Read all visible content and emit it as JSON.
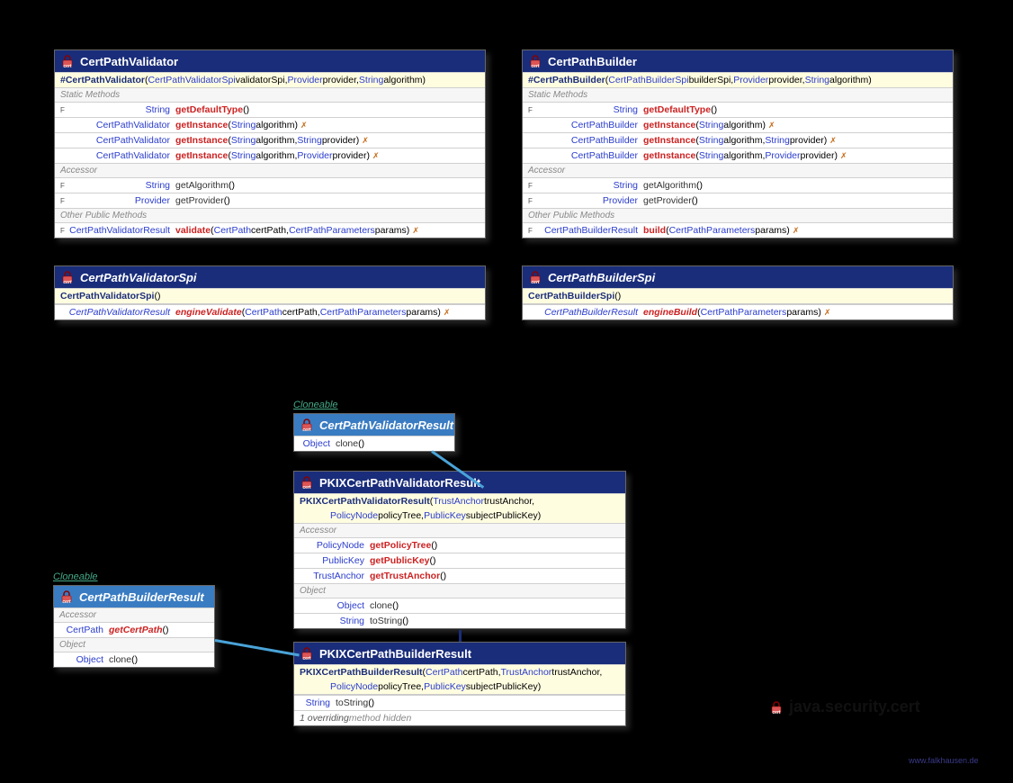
{
  "package": "java.security.cert",
  "footer": "www.falkhausen.de",
  "stereo": {
    "cloneable1": "Cloneable",
    "cloneable2": "Cloneable"
  },
  "classes": {
    "cpv": {
      "name": "CertPathValidator",
      "ctor_prefix": "#",
      "ctor": "CertPathValidator",
      "ctor_args_prefix": " (",
      "ctor_a1_t": "CertPathValidatorSpi",
      "ctor_a1_n": " validatorSpi, ",
      "ctor_a2_t": "Provider",
      "ctor_a2_n": " provider, ",
      "ctor_a3_t": "String",
      "ctor_a3_n": " algorithm)",
      "sec_static": "Static Methods",
      "m1_mod": "F",
      "m1_ret": "String",
      "m1_name": "getDefaultType",
      "m1_args": " ()",
      "m2_ret": "CertPathValidator",
      "m2_name": "getInstance",
      "m2_args_pre": " (",
      "m2_a1_t": "String",
      "m2_a1_n": " algorithm) ",
      "m2_exc": "✗",
      "m3_ret": "CertPathValidator",
      "m3_name": "getInstance",
      "m3_args_pre": " (",
      "m3_a1_t": "String",
      "m3_a1_n": " algorithm, ",
      "m3_a2_t": "String",
      "m3_a2_n": " provider) ",
      "m3_exc": "✗",
      "m4_ret": "CertPathValidator",
      "m4_name": "getInstance",
      "m4_args_pre": " (",
      "m4_a1_t": "String",
      "m4_a1_n": " algorithm, ",
      "m4_a2_t": "Provider",
      "m4_a2_n": " provider) ",
      "m4_exc": "✗",
      "sec_acc": "Accessor",
      "m5_mod": "F",
      "m5_ret": "String",
      "m5_name": "getAlgorithm",
      "m5_args": " ()",
      "m6_mod": "F",
      "m6_ret": "Provider",
      "m6_name": "getProvider",
      "m6_args": " ()",
      "sec_other": "Other Public Methods",
      "m7_mod": "F",
      "m7_ret": "CertPathValidatorResult",
      "m7_name": "validate",
      "m7_args_pre": " (",
      "m7_a1_t": "CertPath",
      "m7_a1_n": " certPath, ",
      "m7_a2_t": "CertPathParameters",
      "m7_a2_n": " params) ",
      "m7_exc": "✗"
    },
    "cpb": {
      "name": "CertPathBuilder",
      "ctor_prefix": "#",
      "ctor": "CertPathBuilder",
      "ctor_args_prefix": " (",
      "ctor_a1_t": "CertPathBuilderSpi",
      "ctor_a1_n": " builderSpi, ",
      "ctor_a2_t": "Provider",
      "ctor_a2_n": " provider, ",
      "ctor_a3_t": "String",
      "ctor_a3_n": " algorithm)",
      "sec_static": "Static Methods",
      "m1_mod": "F",
      "m1_ret": "String",
      "m1_name": "getDefaultType",
      "m1_args": " ()",
      "m2_ret": "CertPathBuilder",
      "m2_name": "getInstance",
      "m2_args_pre": " (",
      "m2_a1_t": "String",
      "m2_a1_n": " algorithm) ",
      "m2_exc": "✗",
      "m3_ret": "CertPathBuilder",
      "m3_name": "getInstance",
      "m3_args_pre": " (",
      "m3_a1_t": "String",
      "m3_a1_n": " algorithm, ",
      "m3_a2_t": "String",
      "m3_a2_n": " provider) ",
      "m3_exc": "✗",
      "m4_ret": "CertPathBuilder",
      "m4_name": "getInstance",
      "m4_args_pre": " (",
      "m4_a1_t": "String",
      "m4_a1_n": " algorithm, ",
      "m4_a2_t": "Provider",
      "m4_a2_n": " provider) ",
      "m4_exc": "✗",
      "sec_acc": "Accessor",
      "m5_mod": "F",
      "m5_ret": "String",
      "m5_name": "getAlgorithm",
      "m5_args": " ()",
      "m6_mod": "F",
      "m6_ret": "Provider",
      "m6_name": "getProvider",
      "m6_args": " ()",
      "sec_other": "Other Public Methods",
      "m7_mod": "F",
      "m7_ret": "CertPathBuilderResult",
      "m7_name": "build",
      "m7_args_pre": " (",
      "m7_a1_t": "CertPathParameters",
      "m7_a1_n": " params) ",
      "m7_exc": "✗"
    },
    "cpvspi": {
      "name": "CertPathValidatorSpi",
      "ctor": "CertPathValidatorSpi",
      "ctor_args": " ()",
      "m1_ret": "CertPathValidatorResult",
      "m1_name": "engineValidate",
      "m1_args_pre": " (",
      "m1_a1_t": "CertPath",
      "m1_a1_n": " certPath, ",
      "m1_a2_t": "CertPathParameters",
      "m1_a2_n": " params) ",
      "m1_exc": "✗"
    },
    "cpbspi": {
      "name": "CertPathBuilderSpi",
      "ctor": "CertPathBuilderSpi",
      "ctor_args": " ()",
      "m1_ret": "CertPathBuilderResult",
      "m1_name": "engineBuild",
      "m1_args_pre": " (",
      "m1_a1_t": "CertPathParameters",
      "m1_a1_n": " params) ",
      "m1_exc": "✗"
    },
    "cpvr_i": {
      "name": "CertPathValidatorResult",
      "m1_ret": "Object",
      "m1_name": "clone",
      "m1_args": " ()"
    },
    "cpbr_i": {
      "name": "CertPathBuilderResult",
      "sec_acc": "Accessor",
      "m1_ret": "CertPath",
      "m1_name": "getCertPath",
      "m1_args": " ()",
      "sec_obj": "Object",
      "m2_ret": "Object",
      "m2_name": "clone",
      "m2_args": " ()"
    },
    "pkixv": {
      "name": "PKIXCertPathValidatorResult",
      "ctor": "PKIXCertPathValidatorResult",
      "ctor_args_pre": " (",
      "ctor_a1_t": "TrustAnchor",
      "ctor_a1_n": " trustAnchor,",
      "ctor_line2_pre": "",
      "ctor_a2_t": "PolicyNode",
      "ctor_a2_n": " policyTree, ",
      "ctor_a3_t": "PublicKey",
      "ctor_a3_n": " subjectPublicKey)",
      "sec_acc": "Accessor",
      "m1_ret": "PolicyNode",
      "m1_name": "getPolicyTree",
      "m1_args": " ()",
      "m2_ret": "PublicKey",
      "m2_name": "getPublicKey",
      "m2_args": " ()",
      "m3_ret": "TrustAnchor",
      "m3_name": "getTrustAnchor",
      "m3_args": " ()",
      "sec_obj": "Object",
      "m4_ret": "Object",
      "m4_name": "clone",
      "m4_args": " ()",
      "m5_ret": "String",
      "m5_name": "toString",
      "m5_args": " ()"
    },
    "pkixb": {
      "name": "PKIXCertPathBuilderResult",
      "ctor": "PKIXCertPathBuilderResult",
      "ctor_args_pre": " (",
      "ctor_a1_t": "CertPath",
      "ctor_a1_n": " certPath, ",
      "ctor_a2_t": "TrustAnchor",
      "ctor_a2_n": " trustAnchor,",
      "ctor_a3_t": "PolicyNode",
      "ctor_a3_n": " policyTree, ",
      "ctor_a4_t": "PublicKey",
      "ctor_a4_n": " subjectPublicKey)",
      "m1_ret": "String",
      "m1_name": "toString",
      "m1_args": " ()",
      "note": "1 overriding",
      "note2": " method hidden"
    }
  }
}
